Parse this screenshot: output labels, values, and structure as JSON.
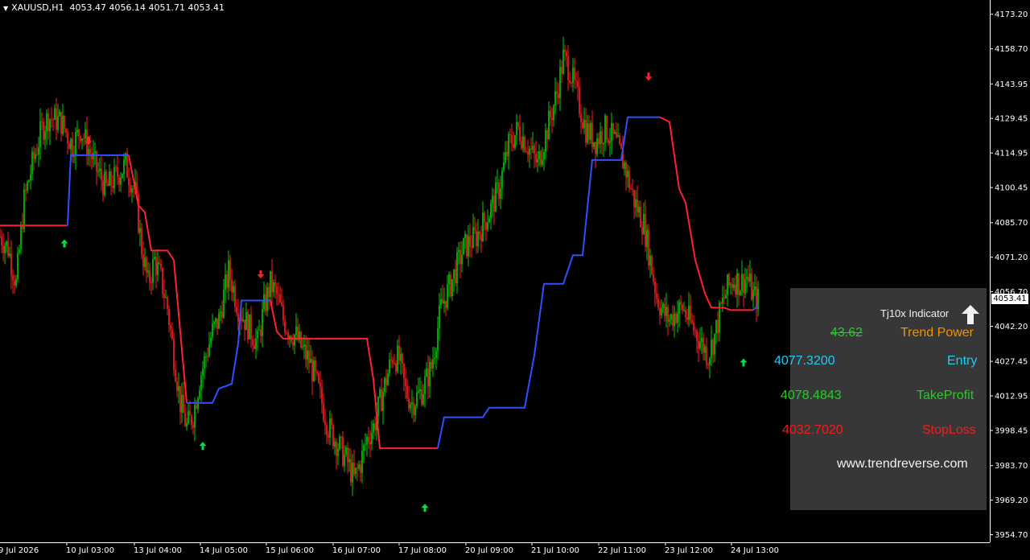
{
  "header": {
    "symbol": "XAUUSD,H1",
    "ohlc": "4053.47 4056.14 4051.71 4053.41"
  },
  "colors": {
    "background": "#000000",
    "bull_candle": "#00d000",
    "bear_candle": "#ff2020",
    "trend_up_line": "#3050ff",
    "trend_down_line": "#ff2030",
    "arrow_up": "#00e040",
    "arrow_down": "#ff2020",
    "axis": "#ffffff"
  },
  "current_price_label": "4053.41",
  "panel": {
    "title": "Tj10x Indicator",
    "direction": "arrow-up",
    "trend_power_value": "43.62",
    "trend_power_label": "Trend Power",
    "entry_value": "4077.3200",
    "entry_label": "Entry",
    "takeprofit_value": "4078.4843",
    "takeprofit_label": "TakeProfit",
    "stoploss_value": "4032.7020",
    "stoploss_label": "StopLoss",
    "website": "www.trendreverse.com"
  },
  "chart_data": {
    "type": "candlestick",
    "y_ticks": [
      4173.2,
      4158.7,
      4143.95,
      4129.45,
      4114.95,
      4100.45,
      4085.7,
      4071.2,
      4056.7,
      4042.2,
      4027.45,
      4012.95,
      3998.45,
      3983.7,
      3969.2,
      3954.7
    ],
    "y_tick_labels": [
      "4173.20",
      "4158.70",
      "4143.95",
      "4129.45",
      "4114.95",
      "4100.45",
      "4085.70",
      "4071.20",
      "4056.70",
      "4042.20",
      "4027.45",
      "4012.95",
      "3998.45",
      "3983.70",
      "3969.20",
      "3954.70"
    ],
    "x_tick_labels": [
      "9 Jul 2026",
      "10 Jul 03:00",
      "13 Jul 04:00",
      "14 Jul 05:00",
      "15 Jul 06:00",
      "16 Jul 07:00",
      "17 Jul 08:00",
      "20 Jul 09:00",
      "21 Jul 10:00",
      "22 Jul 11:00",
      "23 Jul 12:00",
      "24 Jul 13:00"
    ],
    "ylim": [
      3951.5,
      4178.5
    ],
    "bar_count": 230,
    "price_path": [
      [
        0,
        4080
      ],
      [
        5,
        4075
      ],
      [
        10,
        4060
      ],
      [
        15,
        4095
      ],
      [
        20,
        4110
      ],
      [
        26,
        4125
      ],
      [
        30,
        4130
      ],
      [
        38,
        4128
      ],
      [
        45,
        4118
      ],
      [
        50,
        4125
      ],
      [
        56,
        4115
      ],
      [
        60,
        4108
      ],
      [
        66,
        4100
      ],
      [
        72,
        4105
      ],
      [
        78,
        4110
      ],
      [
        84,
        4098
      ],
      [
        88,
        4075
      ],
      [
        92,
        4060
      ],
      [
        96,
        4070
      ],
      [
        100,
        4062
      ],
      [
        104,
        4050
      ],
      [
        108,
        4030
      ],
      [
        112,
        4010
      ],
      [
        116,
        4000
      ],
      [
        120,
        4005
      ],
      [
        124,
        4020
      ],
      [
        128,
        4030
      ],
      [
        132,
        4040
      ],
      [
        136,
        4045
      ],
      [
        139,
        4055
      ],
      [
        142,
        4065
      ],
      [
        145,
        4058
      ],
      [
        148,
        4050
      ],
      [
        152,
        4045
      ],
      [
        156,
        4040
      ],
      [
        160,
        4035
      ],
      [
        164,
        4050
      ],
      [
        168,
        4060
      ],
      [
        172,
        4055
      ],
      [
        176,
        4045
      ],
      [
        180,
        4040
      ],
      [
        184,
        4038
      ],
      [
        188,
        4032
      ],
      [
        192,
        4028
      ],
      [
        196,
        4020
      ],
      [
        200,
        4010
      ],
      [
        204,
        4000
      ],
      [
        208,
        3995
      ],
      [
        212,
        3990
      ],
      [
        216,
        3985
      ],
      [
        220,
        3978
      ],
      [
        224,
        3985
      ],
      [
        228,
        3995
      ],
      [
        232,
        4000
      ],
      [
        236,
        4010
      ],
      [
        240,
        4020
      ],
      [
        244,
        4030
      ],
      [
        248,
        4028
      ],
      [
        252,
        4015
      ],
      [
        256,
        4010
      ],
      [
        262,
        4015
      ],
      [
        268,
        4025
      ],
      [
        274,
        4050
      ],
      [
        280,
        4060
      ],
      [
        288,
        4075
      ],
      [
        296,
        4080
      ],
      [
        304,
        4090
      ],
      [
        310,
        4100
      ],
      [
        316,
        4118
      ],
      [
        322,
        4125
      ],
      [
        328,
        4118
      ],
      [
        334,
        4110
      ],
      [
        340,
        4125
      ],
      [
        346,
        4140
      ],
      [
        350,
        4155
      ],
      [
        354,
        4150
      ],
      [
        358,
        4140
      ],
      [
        364,
        4125
      ],
      [
        370,
        4120
      ],
      [
        376,
        4125
      ],
      [
        382,
        4120
      ],
      [
        388,
        4110
      ],
      [
        394,
        4095
      ],
      [
        400,
        4085
      ],
      [
        404,
        4070
      ],
      [
        408,
        4055
      ],
      [
        412,
        4048
      ],
      [
        416,
        4045
      ],
      [
        420,
        4048
      ],
      [
        424,
        4050
      ],
      [
        428,
        4045
      ],
      [
        432,
        4040
      ],
      [
        436,
        4035
      ],
      [
        440,
        4030
      ],
      [
        444,
        4038
      ],
      [
        448,
        4050
      ],
      [
        452,
        4058
      ],
      [
        456,
        4062
      ],
      [
        460,
        4060
      ],
      [
        464,
        4063
      ],
      [
        468,
        4055
      ],
      [
        471,
        4053.41
      ]
    ],
    "trend_line": [
      {
        "color": "red",
        "points": [
          [
            0,
            4084.5
          ],
          [
            42,
            4084.5
          ]
        ]
      },
      {
        "color": "blue",
        "points": [
          [
            42,
            4084.5
          ],
          [
            44,
            4114
          ],
          [
            80,
            4114
          ]
        ]
      },
      {
        "color": "red",
        "points": [
          [
            80,
            4114
          ],
          [
            86,
            4093
          ],
          [
            90,
            4090
          ],
          [
            94,
            4074
          ],
          [
            104,
            4074
          ],
          [
            108,
            4070
          ],
          [
            112,
            4040
          ],
          [
            116,
            4010
          ]
        ]
      },
      {
        "color": "blue",
        "points": [
          [
            116,
            4010
          ],
          [
            132,
            4010
          ],
          [
            136,
            4016
          ],
          [
            144,
            4018
          ],
          [
            148,
            4035
          ],
          [
            150,
            4053
          ],
          [
            168,
            4053
          ]
        ]
      },
      {
        "color": "red",
        "points": [
          [
            168,
            4053
          ],
          [
            172,
            4040
          ],
          [
            176,
            4037
          ],
          [
            228,
            4037
          ],
          [
            232,
            4020
          ],
          [
            236,
            3991
          ],
          [
            272,
            3991
          ]
        ]
      },
      {
        "color": "blue",
        "points": [
          [
            272,
            3991
          ],
          [
            276,
            4004
          ],
          [
            300,
            4004
          ],
          [
            304,
            4008
          ],
          [
            326,
            4008
          ],
          [
            332,
            4030
          ],
          [
            338,
            4060
          ],
          [
            350,
            4060
          ],
          [
            356,
            4072
          ],
          [
            362,
            4072
          ],
          [
            368,
            4112
          ],
          [
            386,
            4112
          ],
          [
            390,
            4130
          ],
          [
            410,
            4130
          ]
        ]
      },
      {
        "color": "red",
        "points": [
          [
            410,
            4130
          ],
          [
            416,
            4128
          ],
          [
            422,
            4100
          ],
          [
            426,
            4094
          ],
          [
            432,
            4070
          ],
          [
            438,
            4056
          ],
          [
            442,
            4050
          ],
          [
            450,
            4050
          ],
          [
            454,
            4049
          ],
          [
            468,
            4049
          ]
        ]
      },
      {
        "color": "blue",
        "points": [
          [
            468,
            4049
          ],
          [
            471,
            4051
          ]
        ]
      }
    ],
    "signals": [
      {
        "bar": 40,
        "type": "up",
        "price": 4077
      },
      {
        "bar": 55,
        "type": "down",
        "price": 4120
      },
      {
        "bar": 126,
        "type": "up",
        "price": 3992
      },
      {
        "bar": 162,
        "type": "down",
        "price": 4064
      },
      {
        "bar": 264,
        "type": "up",
        "price": 3966
      },
      {
        "bar": 403,
        "type": "down",
        "price": 4147
      },
      {
        "bar": 462,
        "type": "up",
        "price": 4027
      }
    ]
  }
}
